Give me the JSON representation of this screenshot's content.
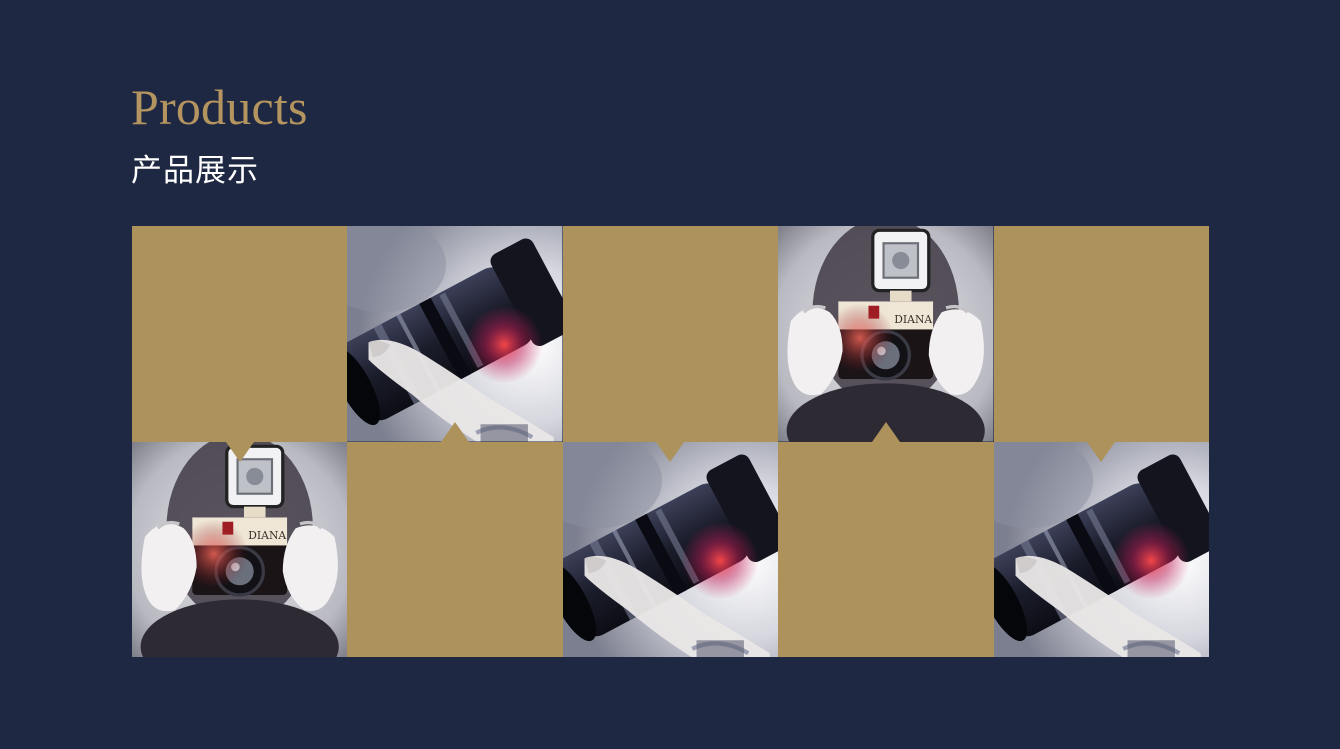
{
  "title": "Products",
  "subtitle": "产品展示",
  "colors": {
    "background": "#1f2843",
    "accent_gold": "#ad925c",
    "title": "#b5955f"
  },
  "gallery": {
    "rows": [
      [
        "gold-tile",
        "photo-lens-camera",
        "gold-tile",
        "photo-vintage-camera",
        "gold-tile"
      ],
      [
        "photo-vintage-camera",
        "gold-tile",
        "photo-lens-camera",
        "gold-tile",
        "photo-lens-camera"
      ]
    ]
  }
}
